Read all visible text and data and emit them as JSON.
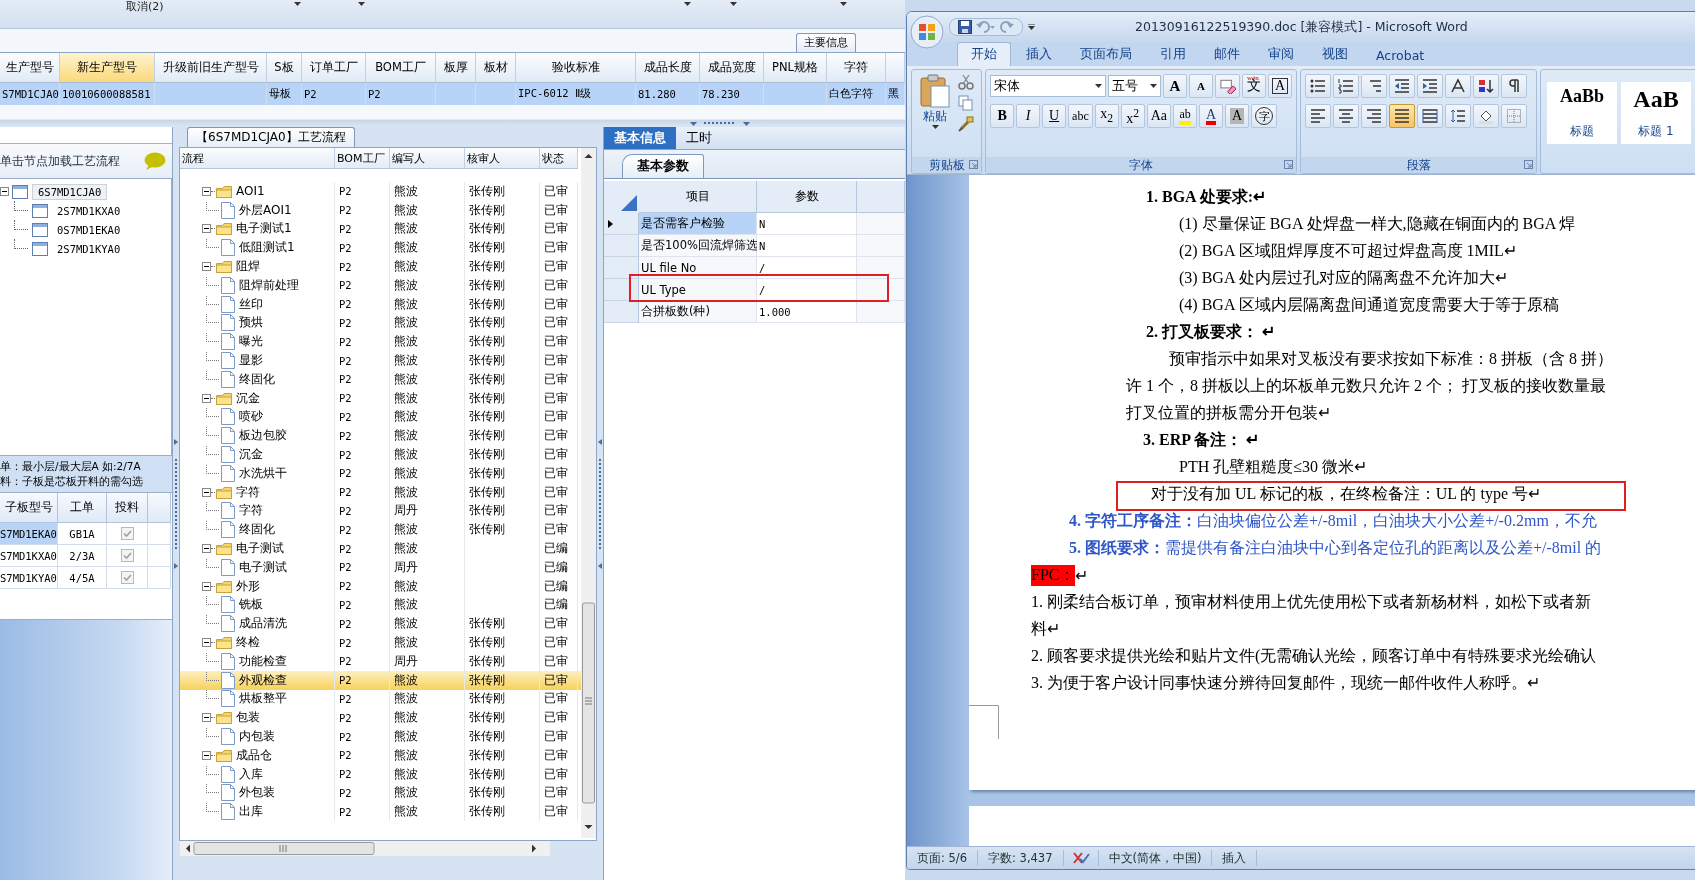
{
  "top_bar": {
    "label": "取消(2)"
  },
  "main_tab": {
    "label": "主要信息"
  },
  "header_table": {
    "columns": [
      {
        "label": "生产型号",
        "selected": false
      },
      {
        "label": "新生产型号",
        "selected": true
      },
      {
        "label": "升级前旧生产型号",
        "selected": false
      },
      {
        "label": "S板",
        "selected": false
      },
      {
        "label": "订单工厂",
        "selected": false
      },
      {
        "label": "BOM工厂",
        "selected": false
      },
      {
        "label": "板厚",
        "selected": false
      },
      {
        "label": "板材",
        "selected": false
      },
      {
        "label": "验收标准",
        "selected": false
      },
      {
        "label": "成品长度",
        "selected": false
      },
      {
        "label": "成品宽度",
        "selected": false
      },
      {
        "label": "PNL规格",
        "selected": false
      },
      {
        "label": "字符",
        "selected": false
      },
      {
        "selected": false
      }
    ],
    "rows": [
      {
        "selected": true,
        "cells": [
          "S7MD1CJA0",
          "10010600088581",
          null,
          "母板",
          "P2",
          "P2",
          null,
          null,
          "IPC-6012 Ⅱ级",
          "81.280",
          "78.230",
          null,
          "白色字符",
          "黑"
        ]
      }
    ]
  },
  "structure_panel": {
    "hint": "单击节点加载工艺流程",
    "tree": [
      {
        "label": "6S7MD1CJA0",
        "selected": true,
        "expanded": true,
        "children": [
          {
            "label": "2S7MD1KXA0",
            "selected": false
          },
          {
            "label": "0S7MD1EKA0",
            "selected": false
          },
          {
            "label": "2S7MD1KYA0",
            "selected": false
          }
        ]
      }
    ],
    "notes": [
      "单：最小层/最大层A 如:2/7A",
      "料：子板是芯板开料的需勾选"
    ],
    "table": {
      "columns": [
        "子板型号",
        "工单",
        "投料"
      ],
      "rows": [
        {
          "board": "S7MD1EKA0",
          "order": "GB1A",
          "feed": true,
          "selected": true
        },
        {
          "board": "S7MD1KXA0",
          "order": "2/3A",
          "feed": true,
          "selected": false
        },
        {
          "board": "S7MD1KYA0",
          "order": "4/5A",
          "feed": true,
          "selected": false
        }
      ]
    }
  },
  "process_panel": {
    "title": "【6S7MD1CJA0】工艺流程",
    "columns": [
      "流程",
      "BOM工厂",
      "编写人",
      "核审人",
      "状态"
    ],
    "rows": [
      {
        "kind": "folder",
        "label": "AOI1",
        "expanded": true,
        "selected": false,
        "bom": "P2",
        "writer": "熊波",
        "reviewer": "张传刚",
        "status": "已审",
        "children": [
          {
            "kind": "step",
            "label": "外层AOI1",
            "selected": false,
            "bom": "P2",
            "writer": "熊波",
            "reviewer": "张传刚",
            "status": "已审"
          }
        ]
      },
      {
        "kind": "folder",
        "label": "电子测试1",
        "expanded": true,
        "selected": false,
        "bom": "P2",
        "writer": "熊波",
        "reviewer": "张传刚",
        "status": "已审",
        "children": [
          {
            "kind": "step",
            "label": "低阻测试1",
            "selected": false,
            "bom": "P2",
            "writer": "熊波",
            "reviewer": "张传刚",
            "status": "已审"
          }
        ]
      },
      {
        "kind": "folder",
        "label": "阻焊",
        "expanded": true,
        "selected": false,
        "bom": "P2",
        "writer": "熊波",
        "reviewer": "张传刚",
        "status": "已审",
        "children": [
          {
            "kind": "step",
            "label": "阻焊前处理",
            "selected": false,
            "bom": "P2",
            "writer": "熊波",
            "reviewer": "张传刚",
            "status": "已审"
          },
          {
            "kind": "step",
            "label": "丝印",
            "selected": false,
            "bom": "P2",
            "writer": "熊波",
            "reviewer": "张传刚",
            "status": "已审"
          },
          {
            "kind": "step",
            "label": "预烘",
            "selected": false,
            "bom": "P2",
            "writer": "熊波",
            "reviewer": "张传刚",
            "status": "已审"
          },
          {
            "kind": "step",
            "label": "曝光",
            "selected": false,
            "bom": "P2",
            "writer": "熊波",
            "reviewer": "张传刚",
            "status": "已审"
          },
          {
            "kind": "step",
            "label": "显影",
            "selected": false,
            "bom": "P2",
            "writer": "熊波",
            "reviewer": "张传刚",
            "status": "已审"
          },
          {
            "kind": "step",
            "label": "终固化",
            "selected": false,
            "bom": "P2",
            "writer": "熊波",
            "reviewer": "张传刚",
            "status": "已审"
          }
        ]
      },
      {
        "kind": "folder",
        "label": "沉金",
        "expanded": true,
        "selected": false,
        "bom": "P2",
        "writer": "熊波",
        "reviewer": "张传刚",
        "status": "已审",
        "children": [
          {
            "kind": "step",
            "label": "喷砂",
            "selected": false,
            "bom": "P2",
            "writer": "熊波",
            "reviewer": "张传刚",
            "status": "已审"
          },
          {
            "kind": "step",
            "label": "板边包胶",
            "selected": false,
            "bom": "P2",
            "writer": "熊波",
            "reviewer": "张传刚",
            "status": "已审"
          },
          {
            "kind": "step",
            "label": "沉金",
            "selected": false,
            "bom": "P2",
            "writer": "熊波",
            "reviewer": "张传刚",
            "status": "已审"
          },
          {
            "kind": "step",
            "label": "水洗烘干",
            "selected": false,
            "bom": "P2",
            "writer": "熊波",
            "reviewer": "张传刚",
            "status": "已审"
          }
        ]
      },
      {
        "kind": "folder",
        "label": "字符",
        "expanded": true,
        "selected": false,
        "bom": "P2",
        "writer": "熊波",
        "reviewer": "张传刚",
        "status": "已审",
        "children": [
          {
            "kind": "step",
            "label": "字符",
            "selected": false,
            "bom": "P2",
            "writer": "周丹",
            "reviewer": "张传刚",
            "status": "已审"
          },
          {
            "kind": "step",
            "label": "终固化",
            "selected": false,
            "bom": "P2",
            "writer": "熊波",
            "reviewer": "张传刚",
            "status": "已审"
          }
        ]
      },
      {
        "kind": "folder",
        "label": "电子测试",
        "expanded": true,
        "selected": false,
        "bom": "P2",
        "writer": "熊波",
        "status": "已编",
        "children": [
          {
            "kind": "step",
            "label": "电子测试",
            "selected": false,
            "bom": "P2",
            "writer": "周丹",
            "status": "已编"
          }
        ]
      },
      {
        "kind": "folder",
        "label": "外形",
        "expanded": true,
        "selected": false,
        "bom": "P2",
        "writer": "熊波",
        "status": "已编",
        "children": [
          {
            "kind": "step",
            "label": "铣板",
            "selected": false,
            "bom": "P2",
            "writer": "熊波",
            "status": "已编"
          },
          {
            "kind": "step",
            "label": "成品清洗",
            "selected": false,
            "bom": "P2",
            "writer": "熊波",
            "reviewer": "张传刚",
            "status": "已审"
          }
        ]
      },
      {
        "kind": "folder",
        "label": "终检",
        "expanded": true,
        "selected": false,
        "bom": "P2",
        "writer": "熊波",
        "reviewer": "张传刚",
        "status": "已审",
        "children": [
          {
            "kind": "step",
            "label": "功能检查",
            "selected": false,
            "bom": "P2",
            "writer": "周丹",
            "reviewer": "张传刚",
            "status": "已审"
          },
          {
            "kind": "step",
            "label": "外观检查",
            "selected": true,
            "bom": "P2",
            "writer": "熊波",
            "reviewer": "张传刚",
            "status": "已审"
          },
          {
            "kind": "step",
            "label": "烘板整平",
            "selected": false,
            "bom": "P2",
            "writer": "熊波",
            "reviewer": "张传刚",
            "status": "已审"
          }
        ]
      },
      {
        "kind": "folder",
        "label": "包装",
        "expanded": true,
        "selected": false,
        "bom": "P2",
        "writer": "熊波",
        "reviewer": "张传刚",
        "status": "已审",
        "children": [
          {
            "kind": "step",
            "label": "内包装",
            "selected": false,
            "bom": "P2",
            "writer": "熊波",
            "reviewer": "张传刚",
            "status": "已审"
          }
        ]
      },
      {
        "kind": "folder",
        "label": "成品仓",
        "expanded": true,
        "selected": false,
        "bom": "P2",
        "writer": "熊波",
        "reviewer": "张传刚",
        "status": "已审",
        "children": [
          {
            "kind": "step",
            "label": "入库",
            "selected": false,
            "bom": "P2",
            "writer": "熊波",
            "reviewer": "张传刚",
            "status": "已审"
          },
          {
            "kind": "step",
            "label": "外包装",
            "selected": false,
            "bom": "P2",
            "writer": "熊波",
            "reviewer": "张传刚",
            "status": "已审"
          },
          {
            "kind": "step",
            "label": "出库",
            "selected": false,
            "bom": "P2",
            "writer": "熊波",
            "reviewer": "张传刚",
            "status": "已审"
          }
        ]
      }
    ]
  },
  "params_panel": {
    "tabs": [
      {
        "label": "基本信息",
        "selected": true
      },
      {
        "label": "工时",
        "selected": false
      }
    ],
    "subtab": "基本参数",
    "columns": [
      "项目",
      "参数"
    ],
    "rows": [
      {
        "item": "是否需客户检验",
        "value": "N",
        "selected": true,
        "annotated": false
      },
      {
        "item": "是否100%回流焊筛选",
        "value": "N",
        "selected": false,
        "annotated": false
      },
      {
        "item": "UL file No",
        "value": "/",
        "selected": false,
        "annotated": false
      },
      {
        "item": "UL Type",
        "value": "/",
        "selected": false,
        "annotated": true
      },
      {
        "item": "合拼板数(种)",
        "value": "1.000",
        "selected": false,
        "annotated": false
      }
    ]
  },
  "word": {
    "title": "20130916122519390.doc [兼容模式] - Microsoft Word",
    "tabs": [
      {
        "label": "开始",
        "selected": true
      },
      {
        "label": "插入",
        "selected": false
      },
      {
        "label": "页面布局",
        "selected": false
      },
      {
        "label": "引用",
        "selected": false
      },
      {
        "label": "邮件",
        "selected": false
      },
      {
        "label": "审阅",
        "selected": false
      },
      {
        "label": "视图",
        "selected": false
      },
      {
        "label": "Acrobat",
        "selected": false
      }
    ],
    "ribbon": {
      "clipboard": {
        "paste": "粘贴",
        "label": "剪贴板"
      },
      "font": {
        "face": "宋体",
        "size": "五号",
        "label": "字体",
        "top_buttons": [
          {
            "kind": "grow",
            "glyph": "A"
          },
          {
            "kind": "shrink",
            "glyph": "A"
          },
          {
            "kind": "clear"
          },
          {
            "kind": "phonetic",
            "glyph": "文",
            "ruby": "wén"
          },
          {
            "kind": "border",
            "glyph": "A"
          }
        ],
        "bottom_buttons": [
          {
            "kind": "bold",
            "glyph": "B"
          },
          {
            "kind": "italic",
            "glyph": "I"
          },
          {
            "kind": "underline",
            "glyph": "U"
          },
          {
            "kind": "strike",
            "glyph": "abc"
          },
          {
            "kind": "script",
            "glyph": "x$_{2}$"
          },
          {
            "kind": "script",
            "glyph": "x$^{2}$"
          },
          {
            "kind": "case",
            "glyph": "Aa"
          },
          {
            "kind": "highlight",
            "glyph": "ab"
          },
          {
            "kind": "color",
            "glyph": "A"
          },
          {
            "kind": "shade",
            "glyph": "A"
          },
          {
            "kind": "enclose",
            "glyph": "字"
          }
        ]
      },
      "paragraph": {
        "label": "段落",
        "align_buttons": [
          {
            "kind": "left",
            "selected": false
          },
          {
            "kind": "center",
            "selected": false
          },
          {
            "kind": "right",
            "selected": false
          },
          {
            "kind": "justify",
            "selected": true
          },
          {
            "kind": "distributed",
            "selected": false
          }
        ]
      },
      "styles": [
        {
          "sample": "AaBb",
          "label": "标题"
        },
        {
          "sample": "AaB",
          "label": "标题 1"
        }
      ]
    },
    "document": {
      "lines": [
        {
          "kind": "heading",
          "text": "1. BGA 处要求:↵"
        },
        {
          "kind": "item",
          "text": "(1) 尽量保证 BGA 处焊盘一样大,隐藏在铜面内的 BGA 焊"
        },
        {
          "kind": "item",
          "text": "(2) BGA 区域阻焊厚度不可超过焊盘高度 1MIL↵"
        },
        {
          "kind": "item",
          "text": "(3) BGA 处内层过孔对应的隔离盘不允许加大↵"
        },
        {
          "kind": "item",
          "text": "(4) BGA 区域内层隔离盘间通道宽度需要大于等于原稿"
        },
        {
          "kind": "heading",
          "text": "2. 打叉板要求： ↵"
        },
        {
          "kind": "para_first",
          "text": "预审指示中如果对叉板没有要求按如下标准：8 拼板（含 8 拼）"
        },
        {
          "kind": "para",
          "text": "许 1 个，8 拼板以上的坏板单元数只允许 2 个；  打叉板的接收数量最"
        },
        {
          "kind": "para",
          "text": "打叉位置的拼板需分开包装↵"
        },
        {
          "kind": "subheading",
          "text": "3. ERP 备注： ↵"
        },
        {
          "kind": "item",
          "text": "PTH 孔壁粗糙度≤30 微米↵"
        },
        {
          "kind": "note",
          "text": "对于没有加 UL 标记的板，在终检备注：UL 的 type 号↵",
          "annotated": true
        },
        {
          "kind": "blue",
          "text": "**4. 字符工序备注：**白油块偏位公差+/-8mil，白油块大小公差+/-0.2mm，不允"
        },
        {
          "kind": "blue",
          "text": "**5. 图纸要求：**需提供有备注白油块中心到各定位孔的距离以及公差+/-8mil 的"
        },
        {
          "kind": "list",
          "text": "FPC：",
          "after": "↵",
          "highlighted": true
        },
        {
          "kind": "list",
          "text": "1.  刚柔结合板订单，预审材料使用上优先使用松下或者新杨材料，如松下或者新"
        },
        {
          "kind": "list",
          "text": "料↵"
        },
        {
          "kind": "list",
          "text": "2.  顾客要求提供光绘和贴片文件(无需确认光绘，顾客订单中有特殊要求光绘确认"
        },
        {
          "kind": "list",
          "text": "3. 为便于客户设计同事快速分辨待回复邮件，现统一邮件收件人称呼。↵"
        }
      ]
    },
    "status_bar": [
      {
        "kind": "text",
        "text": "页面: 5/6"
      },
      {
        "kind": "text",
        "text": "字数: 3,437"
      },
      {
        "kind": "proofing"
      },
      {
        "kind": "text",
        "text": "中文(简体，中国)"
      },
      {
        "kind": "text",
        "text": "插入"
      }
    ]
  }
}
